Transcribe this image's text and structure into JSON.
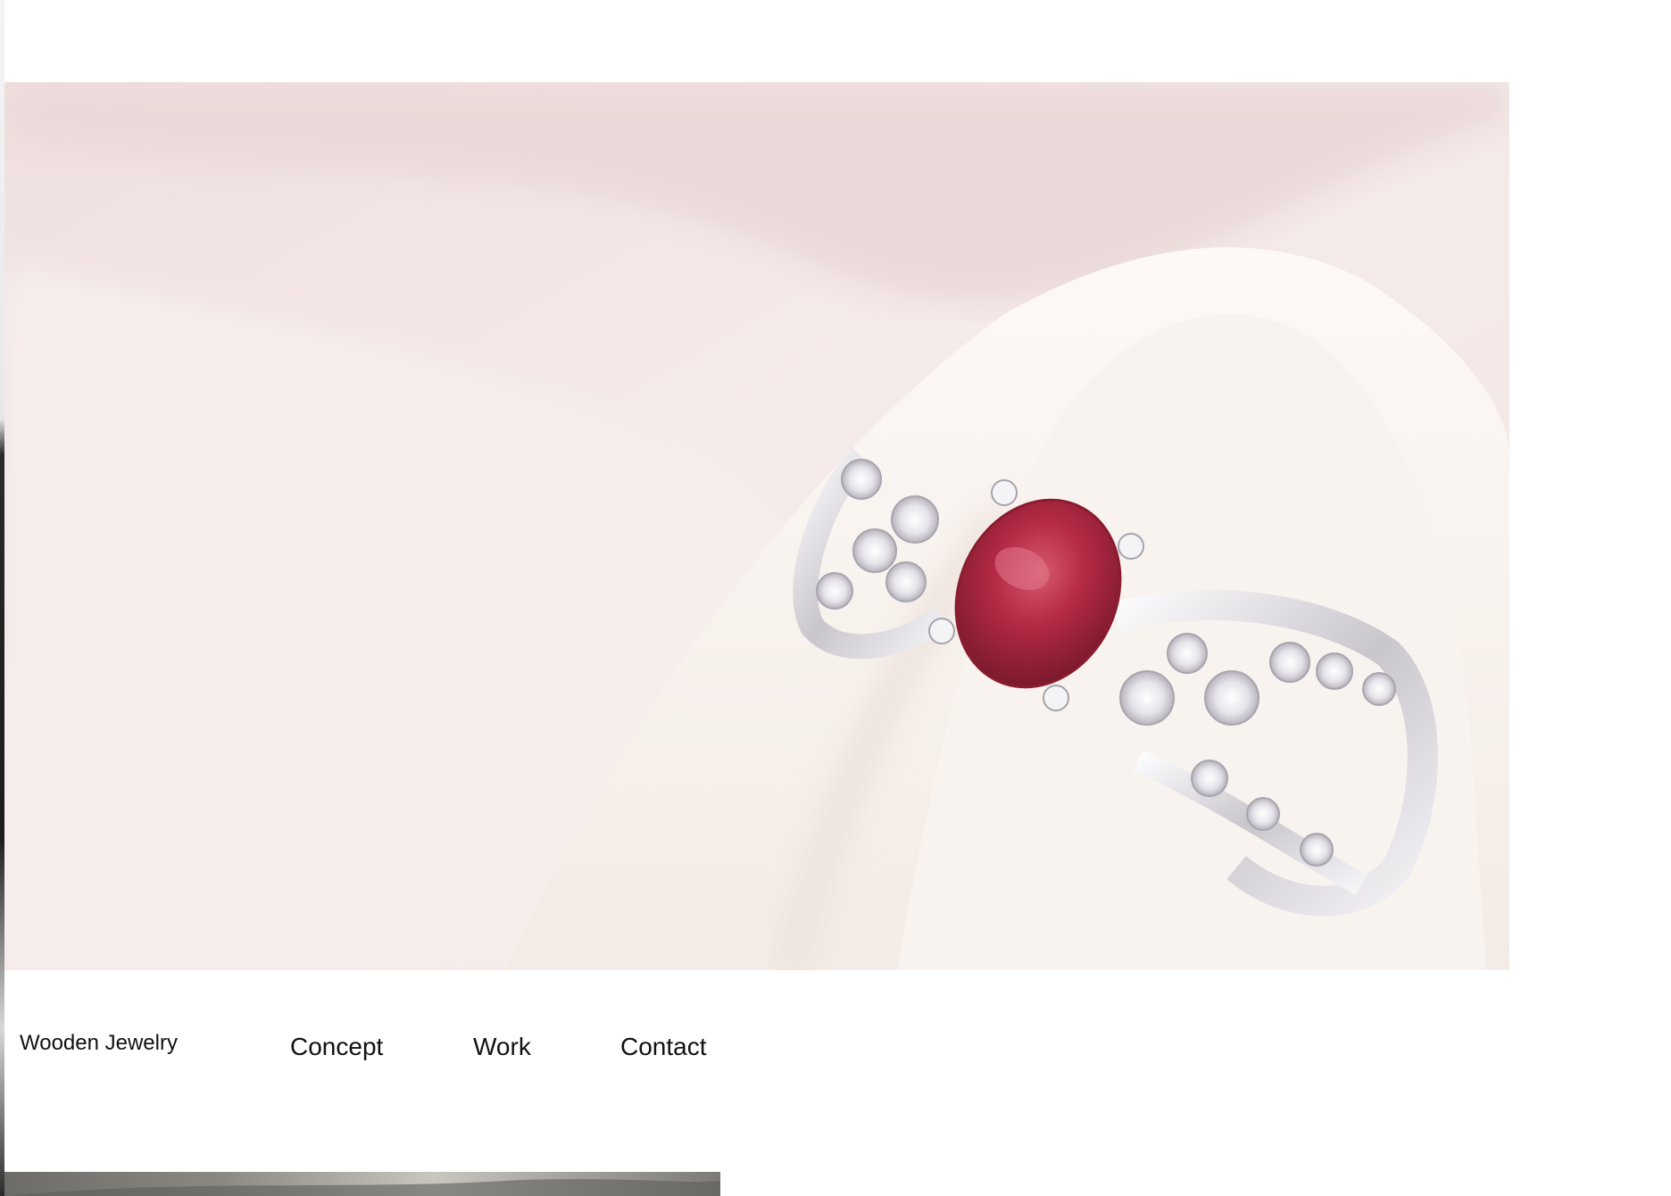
{
  "site": {
    "brand": "Wooden Jewelry"
  },
  "nav": {
    "items": [
      {
        "label": "Concept"
      },
      {
        "label": "Work"
      },
      {
        "label": "Contact"
      }
    ]
  },
  "hero": {
    "subject": "ruby-ring-on-cream-fabric"
  },
  "colors": {
    "background": "#ffffff",
    "text": "#111111",
    "fabric": "#f3e7e6",
    "ruby": "#b8263f",
    "silver": "#e8e6ea"
  }
}
